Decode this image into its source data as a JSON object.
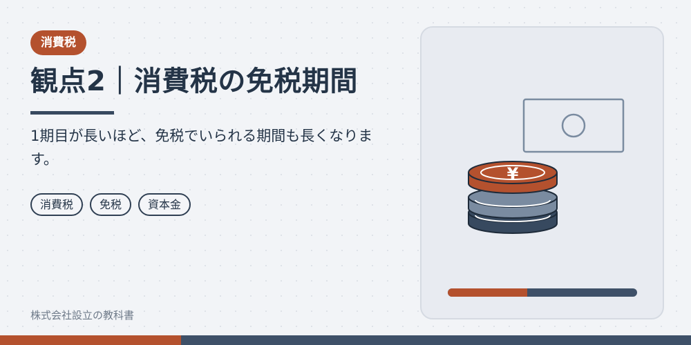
{
  "badge": "消費税",
  "title": "観点2｜消費税の免税期間",
  "description": "1期目が長いほど、免税でいられる期間も長くなります。",
  "tags": [
    "消費税",
    "免税",
    "資本金"
  ],
  "footer": "株式会社設立の教科書",
  "illustration": {
    "coin_symbol": "¥",
    "progress": 0.42,
    "icons": [
      "banknote-icon",
      "coin-stack-icon"
    ]
  },
  "colors": {
    "accent": "#b4512e",
    "navy": "#37495f",
    "slate": "#7a8ba0",
    "text": "#243447",
    "background": "#f2f4f7"
  }
}
